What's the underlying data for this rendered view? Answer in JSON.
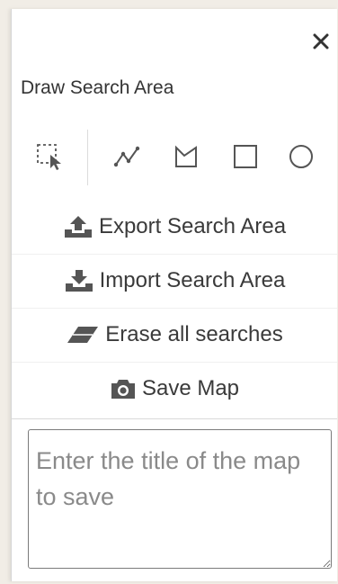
{
  "panel": {
    "title": "Draw Search Area",
    "close_glyph": "✕"
  },
  "tools": [
    {
      "name": "select-tool",
      "icon": "dashed-select-cursor-icon"
    },
    {
      "name": "polyline-tool",
      "icon": "polyline-icon"
    },
    {
      "name": "polygon-tool",
      "icon": "polygon-icon"
    },
    {
      "name": "rectangle-tool",
      "icon": "rectangle-icon"
    },
    {
      "name": "circle-tool",
      "icon": "circle-icon"
    }
  ],
  "actions": {
    "export_label": "Export Search Area",
    "import_label": "Import Search Area",
    "erase_label": "Erase all searches",
    "save_label": "Save Map"
  },
  "save_form": {
    "placeholder": "Enter the title of the map to save",
    "value": ""
  },
  "colors": {
    "icon": "#555555",
    "text": "#3a3a3a",
    "border": "#7b7b7b"
  }
}
